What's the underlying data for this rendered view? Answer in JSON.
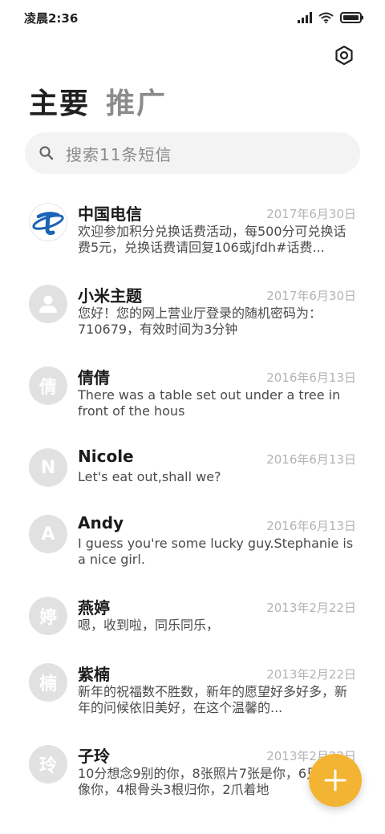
{
  "status_bar": {
    "time": "凌晨2:36",
    "icons": [
      "signal-icon",
      "wifi-icon",
      "battery-icon"
    ]
  },
  "header": {
    "settings_icon": "settings-icon",
    "tabs": [
      {
        "label": "主要",
        "active": true
      },
      {
        "label": "推广",
        "active": false
      }
    ]
  },
  "search": {
    "icon": "search-icon",
    "placeholder": "搜索11条短信"
  },
  "conversations": [
    {
      "name": "中国电信",
      "date": "2017年6月30日",
      "preview": "欢迎参加积分兑换话费活动，每500分可兑换话费5元，兑换话费请回复106或jfdh#话费...",
      "avatar": "brand"
    },
    {
      "name": "小米主题",
      "date": "2017年6月30日",
      "preview": "您好！您的网上营业厅登录的随机密码为：710679，有效时间为3分钟",
      "avatar": "person"
    },
    {
      "name": "倩倩",
      "date": "2016年6月13日",
      "preview": "There was a table set out under a tree in front of the hous",
      "avatar": "倩"
    },
    {
      "name": "Nicole",
      "date": "2016年6月13日",
      "preview": "Let's eat out,shall we?",
      "avatar": "N"
    },
    {
      "name": "Andy",
      "date": "2016年6月13日",
      "preview": "I guess you're some lucky guy.Stephanie is a nice girl.",
      "avatar": "A"
    },
    {
      "name": "燕婷",
      "date": "2013年2月22日",
      "preview": "嗯，收到啦，同乐同乐，",
      "avatar": "婷"
    },
    {
      "name": "紫楠",
      "date": "2013年2月22日",
      "preview": "新年的祝福数不胜数，新年的愿望好多好多，新年的问候依旧美好，在这个温馨的...",
      "avatar": "楠"
    },
    {
      "name": "子玲",
      "date": "2013年2月22日",
      "preview": "10分想念9别的你，8张照片7张是你，6只狗5只像你，4根骨头3根归你，2爪着地",
      "avatar": "玲"
    }
  ],
  "fab": {
    "icon": "plus-icon"
  },
  "colors": {
    "accent": "#f4b433",
    "brand_blue": "#1b64b5",
    "avatar_bg": "#e1e1e1",
    "date_text": "#b3b3b3"
  }
}
